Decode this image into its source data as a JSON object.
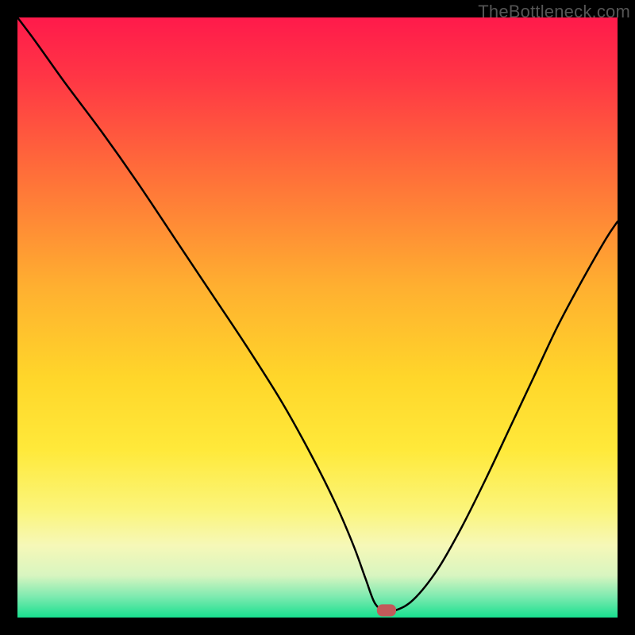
{
  "watermark": "TheBottleneck.com",
  "chart_data": {
    "type": "line",
    "title": "",
    "xlabel": "",
    "ylabel": "",
    "xlim": [
      0,
      100
    ],
    "ylim": [
      0,
      100
    ],
    "grid": false,
    "legend": false,
    "annotations": [],
    "background_gradient_stops": [
      {
        "pos": 0.0,
        "color": "#ff1a4b"
      },
      {
        "pos": 0.1,
        "color": "#ff3645"
      },
      {
        "pos": 0.25,
        "color": "#ff6b3a"
      },
      {
        "pos": 0.45,
        "color": "#ffb030"
      },
      {
        "pos": 0.6,
        "color": "#ffd62a"
      },
      {
        "pos": 0.72,
        "color": "#ffe93a"
      },
      {
        "pos": 0.82,
        "color": "#fbf57a"
      },
      {
        "pos": 0.88,
        "color": "#f6f8b8"
      },
      {
        "pos": 0.93,
        "color": "#d8f5c0"
      },
      {
        "pos": 0.965,
        "color": "#7eeab0"
      },
      {
        "pos": 1.0,
        "color": "#18e08f"
      }
    ],
    "series": [
      {
        "name": "bottleneck-curve",
        "color": "#000000",
        "x": [
          0,
          3,
          8,
          14,
          20,
          26,
          32,
          38,
          44,
          49,
          53,
          56,
          58,
          59.5,
          61,
          63,
          66,
          70,
          74,
          78,
          82,
          86,
          90,
          94,
          98,
          100
        ],
        "y": [
          100,
          96,
          89,
          81,
          72.5,
          63.5,
          54.5,
          45.5,
          36,
          27,
          19,
          12,
          6.5,
          2.5,
          1.2,
          1.2,
          3,
          8,
          15,
          23,
          31.5,
          40,
          48.5,
          56,
          63,
          66
        ]
      }
    ],
    "marker": {
      "x": 61.5,
      "y": 1.2,
      "rx": 1.6,
      "ry": 1.0,
      "fill": "#c25a5a"
    }
  }
}
